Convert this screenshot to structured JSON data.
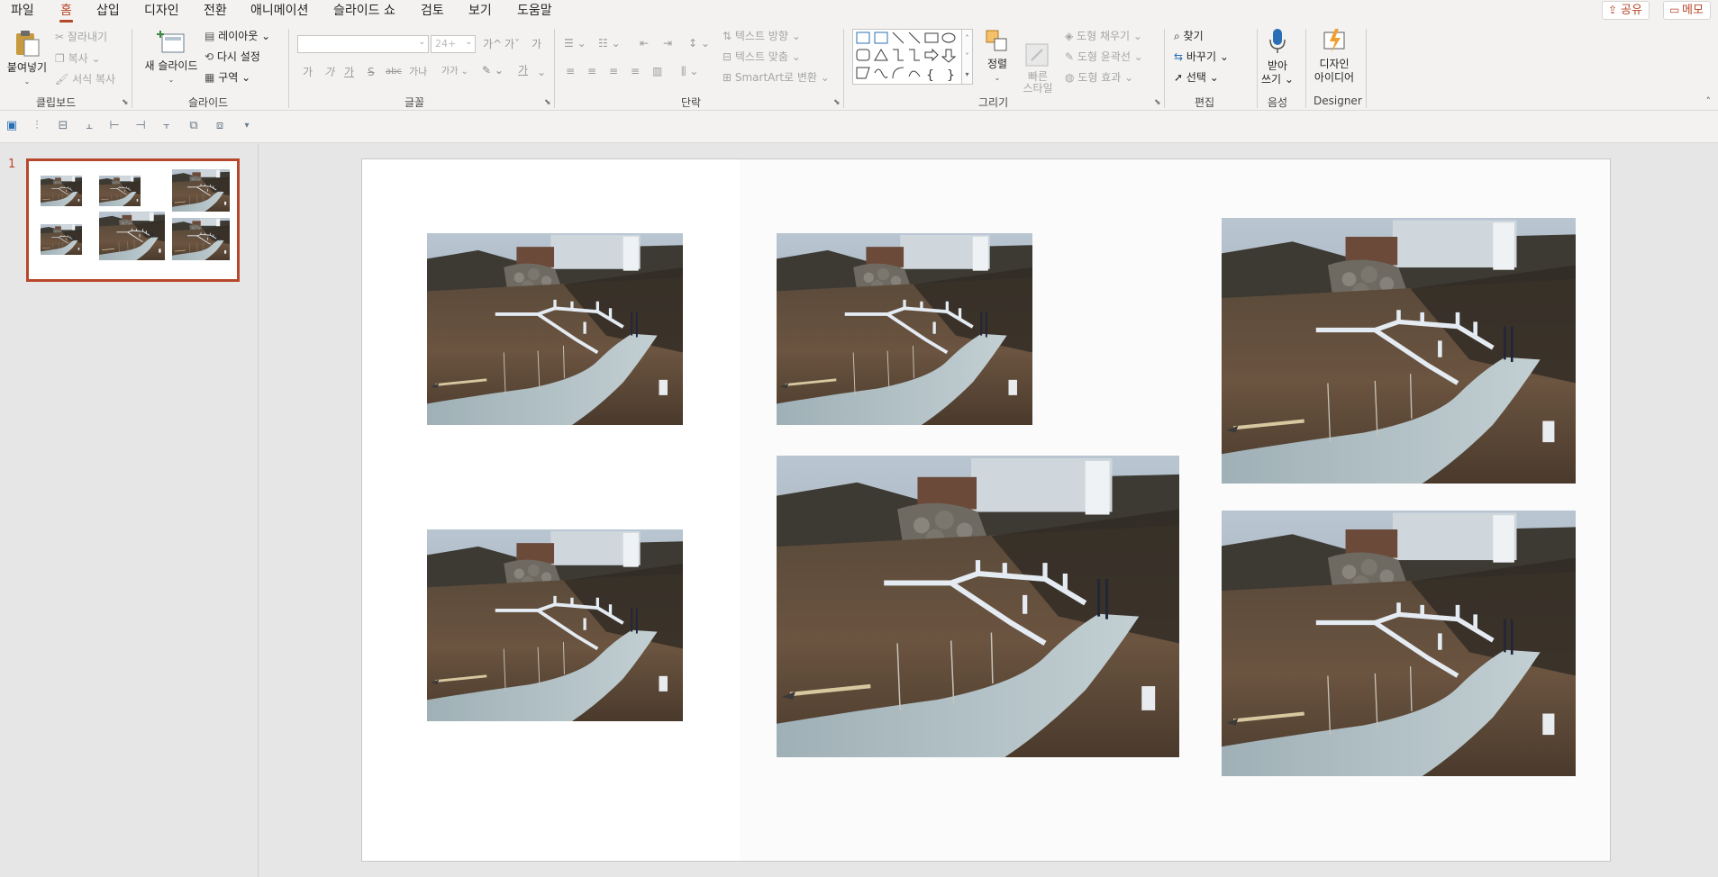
{
  "menu": {
    "tabs": [
      "파일",
      "홈",
      "삽입",
      "디자인",
      "전환",
      "애니메이션",
      "슬라이드 쇼",
      "검토",
      "보기",
      "도움말"
    ],
    "active_tab": "홈",
    "share_label": "공유",
    "comment_label": "메모"
  },
  "ribbon": {
    "clipboard": {
      "label": "클립보드",
      "paste": "붙여넣기",
      "cut": "잘라내기",
      "copy": "복사",
      "format_painter": "서식 복사"
    },
    "slides": {
      "label": "슬라이드",
      "new_slide": "새 슬라이드",
      "layout": "레이아웃",
      "reset": "다시 설정",
      "section": "구역"
    },
    "font": {
      "label": "글꼴",
      "font_name": "",
      "font_size": "24+",
      "bold": "가",
      "italic": "가",
      "underline": "가",
      "strike": "S",
      "spacing": "abc",
      "case": "가나",
      "grow": "가^",
      "shrink": "가ˇ",
      "clear": "가",
      "highlight": "가"
    },
    "paragraph": {
      "label": "단락",
      "text_direction": "텍스트 방향",
      "align_text": "텍스트 맞춤",
      "smartart": "SmartArt로 변환"
    },
    "drawing": {
      "label": "그리기",
      "arrange": "정렬",
      "quick_styles": "빠른\n스타일",
      "shape_fill": "도형 채우기",
      "shape_outline": "도형 윤곽선",
      "shape_effects": "도형 효과"
    },
    "editing": {
      "label": "편집",
      "find": "찾기",
      "replace": "바꾸기",
      "select": "선택"
    },
    "voice": {
      "label": "음성",
      "dictate_line1": "받아",
      "dictate_line2": "쓰기"
    },
    "designer": {
      "label": "Designer",
      "ideas_line1": "디자인",
      "ideas_line2": "아이디어"
    }
  },
  "thumbnail_pane": {
    "slide_number": "1"
  },
  "colors": {
    "accent": "#b7472a",
    "ribbon_bg": "#f3f2f1",
    "workspace_bg": "#e6e6e6"
  }
}
